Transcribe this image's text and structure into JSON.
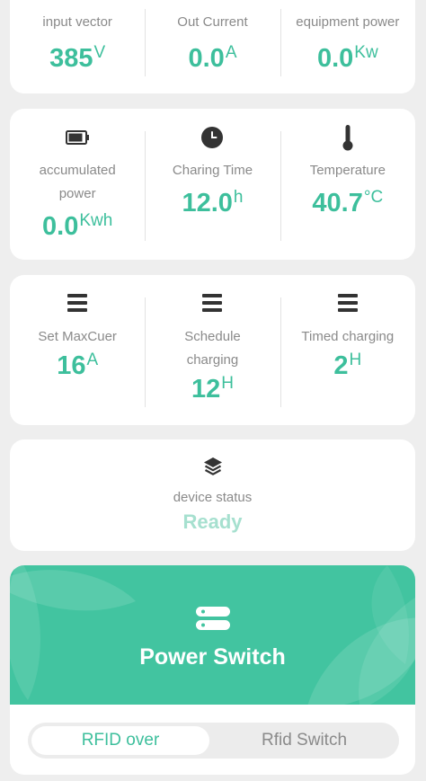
{
  "stats_top": [
    {
      "label": "input vector",
      "value": "385",
      "unit": "V"
    },
    {
      "label": "Out Current",
      "value": "0.0",
      "unit": "A"
    },
    {
      "label": "equipment power",
      "value": "0.0",
      "unit": "Kw"
    }
  ],
  "stats_mid": [
    {
      "icon": "battery-icon",
      "label_line1": "accumulated",
      "label_line2": "power",
      "value": "0.0",
      "unit": "Kwh"
    },
    {
      "icon": "clock-icon",
      "label": "Charing Time",
      "value": "12.0",
      "unit": "h"
    },
    {
      "icon": "thermometer-icon",
      "label": "Temperature",
      "value": "40.7",
      "unit": "°C"
    }
  ],
  "settings": [
    {
      "icon": "menu-icon",
      "label": "Set MaxCuer",
      "value": "16",
      "unit": "A"
    },
    {
      "icon": "menu-icon",
      "label_line1": "Schedule",
      "label_line2": "charging",
      "value": "12",
      "unit": "H"
    },
    {
      "icon": "menu-icon",
      "label": "Timed charging",
      "value": "2",
      "unit": "H"
    }
  ],
  "device": {
    "icon": "layers-icon",
    "label": "device status",
    "status": "Ready"
  },
  "power": {
    "icon": "switch-icon",
    "title": "Power Switch"
  },
  "toggle": {
    "selected": "RFID over",
    "other": "Rfid Switch"
  },
  "colors": {
    "accent": "#3dbf9c",
    "hero": "#42c4a0",
    "status_light": "#a6e0cf",
    "label": "#8a8a8a"
  }
}
